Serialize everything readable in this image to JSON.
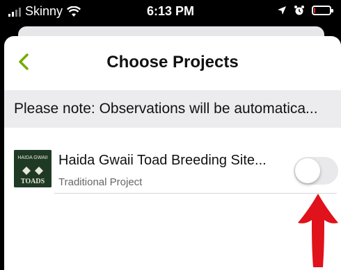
{
  "status_bar": {
    "carrier": "Skinny",
    "time": "6:13 PM",
    "battery_level_fraction": 0.1,
    "battery_color": "#e0282e"
  },
  "header": {
    "title": "Choose Projects",
    "back_icon": "chevron-left-icon",
    "accent_color": "#74ac00"
  },
  "notice": {
    "text": "Please note: Observations will be automatica..."
  },
  "projects": [
    {
      "title": "Haida Gwaii Toad Breeding Site...",
      "subtitle": "Traditional Project",
      "logo_text_top": "HAIDA GWAII",
      "logo_text_bottom": "TOADS",
      "toggle_on": false
    }
  ],
  "annotation": {
    "icon": "red-arrow-up-icon",
    "color": "#e0121b"
  }
}
